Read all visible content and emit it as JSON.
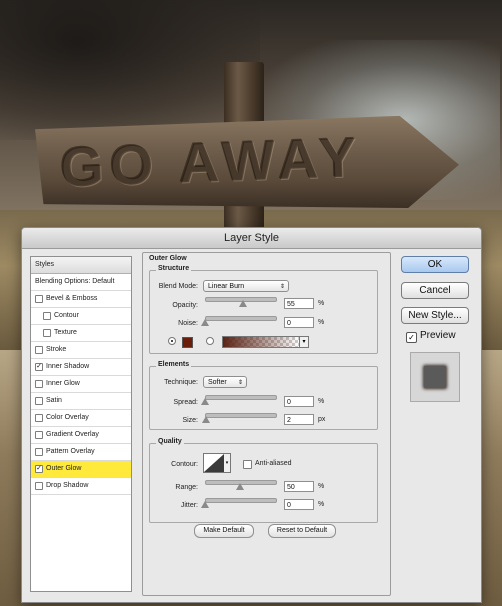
{
  "background": {
    "sign_text": "GO AWAY"
  },
  "dialog": {
    "title": "Layer Style"
  },
  "styles_panel": {
    "header": "Styles",
    "blending": "Blending Options: Default",
    "items": [
      {
        "label": "Bevel & Emboss",
        "checked": false
      },
      {
        "label": "Contour",
        "checked": false,
        "indent": true
      },
      {
        "label": "Texture",
        "checked": false,
        "indent": true
      },
      {
        "label": "Stroke",
        "checked": false
      },
      {
        "label": "Inner Shadow",
        "checked": true
      },
      {
        "label": "Inner Glow",
        "checked": false
      },
      {
        "label": "Satin",
        "checked": false
      },
      {
        "label": "Color Overlay",
        "checked": false
      },
      {
        "label": "Gradient Overlay",
        "checked": false
      },
      {
        "label": "Pattern Overlay",
        "checked": false
      },
      {
        "label": "Outer Glow",
        "checked": true,
        "selected": true
      },
      {
        "label": "Drop Shadow",
        "checked": false
      }
    ]
  },
  "outer_glow": {
    "title": "Outer Glow",
    "structure": {
      "title": "Structure",
      "blend_mode_label": "Blend Mode:",
      "blend_mode": "Linear Burn",
      "opacity_label": "Opacity:",
      "opacity": "55",
      "noise_label": "Noise:",
      "noise": "0",
      "percent": "%",
      "color_mode": "color",
      "color": "#6b1d0c"
    },
    "elements": {
      "title": "Elements",
      "technique_label": "Technique:",
      "technique": "Softer",
      "spread_label": "Spread:",
      "spread": "0",
      "size_label": "Size:",
      "size": "2",
      "percent": "%",
      "px": "px"
    },
    "quality": {
      "title": "Quality",
      "contour_label": "Contour:",
      "anti_aliased": "Anti-aliased",
      "range_label": "Range:",
      "range": "50",
      "jitter_label": "Jitter:",
      "jitter": "0",
      "percent": "%"
    },
    "make_default": "Make Default",
    "reset_default": "Reset to Default"
  },
  "buttons": {
    "ok": "OK",
    "cancel": "Cancel",
    "new_style": "New Style...",
    "preview": "Preview"
  }
}
